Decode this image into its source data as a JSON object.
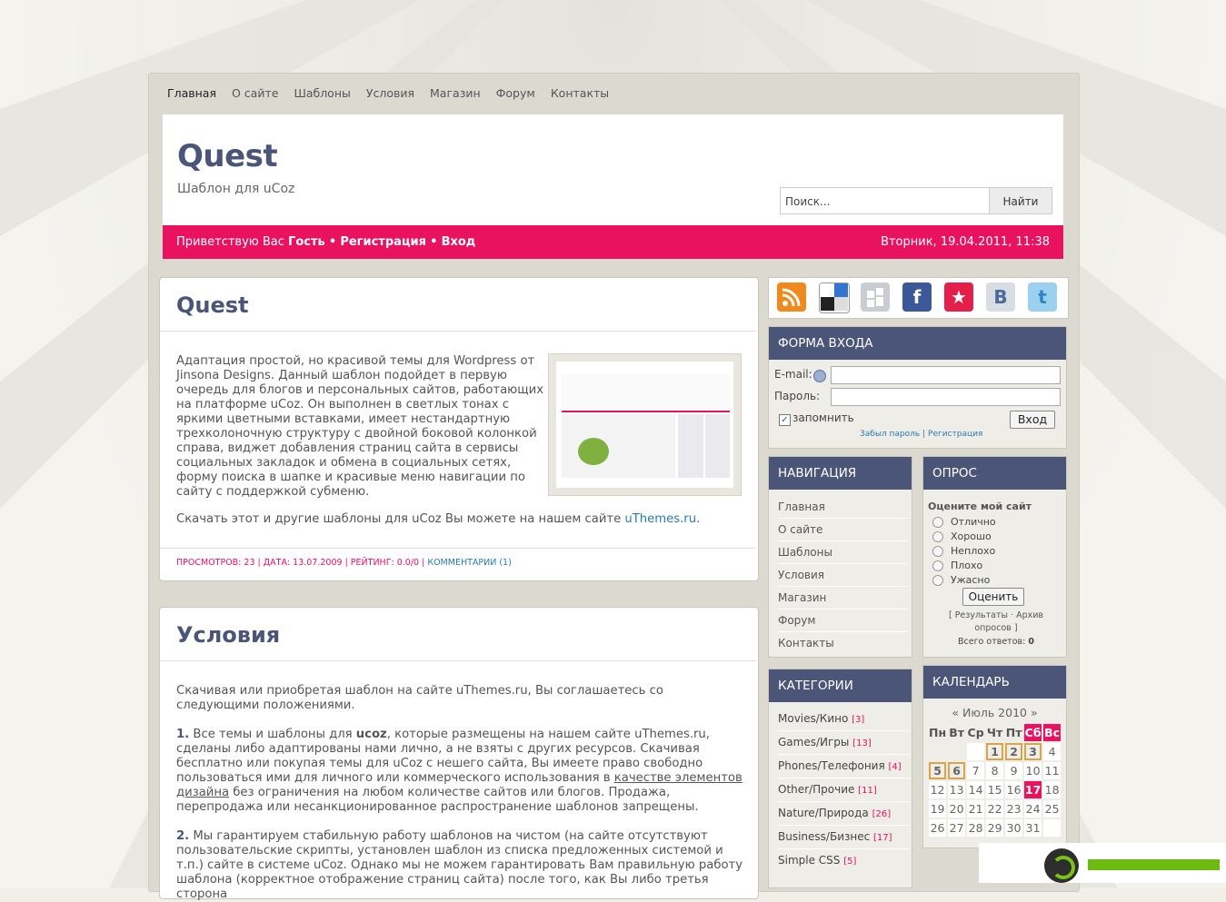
{
  "nav": [
    "Главная",
    "О сайте",
    "Шаблоны",
    "Условия",
    "Магазин",
    "Форум",
    "Контакты"
  ],
  "header": {
    "title": "Quest",
    "subtitle": "Шаблон для uCoz",
    "search_placeholder": "Поиск...",
    "search_button": "Найти"
  },
  "welcome": {
    "prefix": "Приветствую Вас",
    "guest": "Гость",
    "sep": "•",
    "register": "Регистрация",
    "login": "Вход",
    "datetime": "Вторник, 19.04.2011, 11:38"
  },
  "post1": {
    "title": "Quest",
    "body": "Адаптация простой, но красивой темы для Wordpress от Jinsona Designs. Данный шаблон подойдет в первую очередь для блогов и персональных сайтов, работающих на платформе uCoz. Он выполнен в светлых тонах с яркими цветными вставками, имеет нестандартную трехколоночную структуру с двойной боковой колонкой справа, виджет добавления страниц сайта в сервисы социальных закладок и обмена в социальных сетях, форму поиска в шапке и красивые меню навигации по сайту с поддержкой субменю.",
    "download_text": "Скачать этот и другие шаблоны для uCoz Вы можете на нашем сайте",
    "download_link": "uThemes.ru",
    "meta": "ПРОСМОТРОВ: 23 | ДАТА: 13.07.2009 | РЕЙТИНГ: 0.0/0 |",
    "comments": "КОММЕНТАРИИ (1)"
  },
  "post2": {
    "title": "Условия",
    "intro": "Скачивая или приобретая шаблон на сайте uThemes.ru, Вы соглашаетесь со следующими положениями.",
    "p1_num": "1.",
    "p1_a": "Все темы и шаблоны для",
    "p1_b": "ucoz",
    "p1_c": ", которые размещены на нашем сайте uThemes.ru, сделаны либо адаптированы нами лично, а не взяты с других ресурсов. Скачивая бесплатно или покупая темы для uCoz с нешего сайта, Вы имеете право свободно пользоваться ими для личного или коммерческого использования в",
    "p1_link": "качестве элементов дизайна",
    "p1_d": "без ограничения на любом количестве сайтов или блогов. Продажа, перепродажа или несанкционированное распространение шаблонов запрещены.",
    "p2_num": "2.",
    "p2": "Мы гарантируем стабильную работу шаблонов на чистом (на сайте отсутствуют пользовательские скрипты, установлен шаблон из списка предложенных системой и т.п.) сайте в системе uCoz. Однако мы не можем гарантировать Вам правильную работу шаблона (корректное отображение страниц сайта) после того, как Вы либо третья сторона"
  },
  "social_icons": [
    "rss-icon",
    "delicious-icon",
    "digg-icon",
    "facebook-icon",
    "bookmark-star-icon",
    "vkontakte-icon",
    "twitter-icon"
  ],
  "login_form": {
    "title": "ФОРМА ВХОДА",
    "email_label": "E-mail:",
    "password_label": "Пароль:",
    "remember": "запомнить",
    "submit": "Вход",
    "forgot": "Забыл пароль",
    "sep": "|",
    "register": "Регистрация"
  },
  "navigation": {
    "title": "НАВИГАЦИЯ",
    "items": [
      "Главная",
      "О сайте",
      "Шаблоны",
      "Условия",
      "Магазин",
      "Форум",
      "Контакты"
    ]
  },
  "poll": {
    "title": "ОПРОС",
    "question": "Оцените мой сайт",
    "options": [
      "Отлично",
      "Хорошо",
      "Неплохо",
      "Плохо",
      "Ужасно"
    ],
    "button": "Оценить",
    "results": "Результаты",
    "archive_a": "Архив",
    "archive_b": "опросов",
    "total_label": "Всего ответов:",
    "total": "0"
  },
  "categories": {
    "title": "КАТЕГОРИИ",
    "items": [
      {
        "name": "Movies/Кино",
        "count": "[3]"
      },
      {
        "name": "Games/Игры",
        "count": "[13]"
      },
      {
        "name": "Phones/Телефония",
        "count": "[4]"
      },
      {
        "name": "Other/Прочие",
        "count": "[11]"
      },
      {
        "name": "Nature/Природа",
        "count": "[26]"
      },
      {
        "name": "Business/Бизнес",
        "count": "[17]"
      },
      {
        "name": "Simple CSS",
        "count": "[5]"
      }
    ]
  },
  "calendar": {
    "title": "КАЛЕНДАРЬ",
    "prev": "«",
    "month": "Июль 2010",
    "next": "»",
    "days": [
      "Пн",
      "Вт",
      "Ср",
      "Чт",
      "Пт",
      "Сб",
      "Вс"
    ],
    "rows": [
      [
        "",
        "",
        "",
        "1",
        "2",
        "3",
        "4"
      ],
      [
        "5",
        "6",
        "7",
        "8",
        "9",
        "10",
        "11"
      ],
      [
        "12",
        "13",
        "14",
        "15",
        "16",
        "17",
        "18"
      ],
      [
        "19",
        "20",
        "21",
        "22",
        "23",
        "24",
        "25"
      ],
      [
        "26",
        "27",
        "28",
        "29",
        "30",
        "31",
        ""
      ]
    ]
  },
  "colors": {
    "accent": "#e8125f",
    "header_blue": "#4a5577",
    "link": "#2a7ab0"
  }
}
